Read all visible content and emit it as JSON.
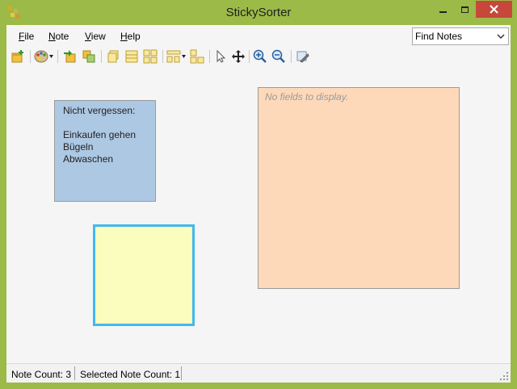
{
  "window": {
    "title": "StickySorter"
  },
  "menu": {
    "items": [
      {
        "key": "F",
        "rest": "ile"
      },
      {
        "key": "N",
        "rest": "ote"
      },
      {
        "key": "V",
        "rest": "iew"
      },
      {
        "key": "H",
        "rest": "elp"
      }
    ]
  },
  "search": {
    "selected": "Find Notes"
  },
  "toolbar": {
    "icons": [
      "new-note-icon",
      "palette-icon",
      "import-icon",
      "export-icon",
      "stack-view-icon",
      "list-view-icon",
      "grid-view-icon",
      "arrange-icon",
      "group-icon",
      "select-icon",
      "pan-icon",
      "zoom-in-icon",
      "zoom-out-icon",
      "settings-icon"
    ]
  },
  "notes": {
    "blue": {
      "lines": [
        "Nicht vergessen:",
        "",
        "Einkaufen gehen",
        "Bügeln",
        "Abwaschen"
      ],
      "color": "#adc8e3"
    },
    "yellow": {
      "color": "#fafdbe",
      "selected": true,
      "border_color": "#40b9ee"
    },
    "peach": {
      "placeholder": "No fields to display.",
      "color": "#fed9b9"
    }
  },
  "status": {
    "note_count": "Note Count: 3",
    "selected_count": "Selected Note Count: 1"
  },
  "colors": {
    "frame": "#9bba48",
    "close_button": "#c7483b",
    "background": "#f5f5f5"
  }
}
